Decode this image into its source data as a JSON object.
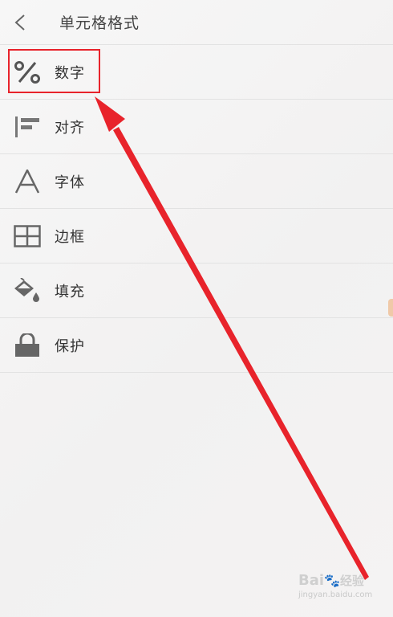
{
  "header": {
    "title": "单元格格式",
    "back_icon": "chevron-left-icon"
  },
  "menu": {
    "items": [
      {
        "label": "数字",
        "icon": "percent-icon"
      },
      {
        "label": "对齐",
        "icon": "align-left-icon"
      },
      {
        "label": "字体",
        "icon": "font-icon"
      },
      {
        "label": "边框",
        "icon": "border-grid-icon"
      },
      {
        "label": "填充",
        "icon": "fill-bucket-icon"
      },
      {
        "label": "保护",
        "icon": "lock-icon"
      }
    ]
  },
  "annotation": {
    "color": "#e8232b",
    "highlighted_item": "数字"
  },
  "watermark": {
    "brand": "Bai",
    "brand_suffix": "经验",
    "site": "jingyan.baidu.com"
  }
}
